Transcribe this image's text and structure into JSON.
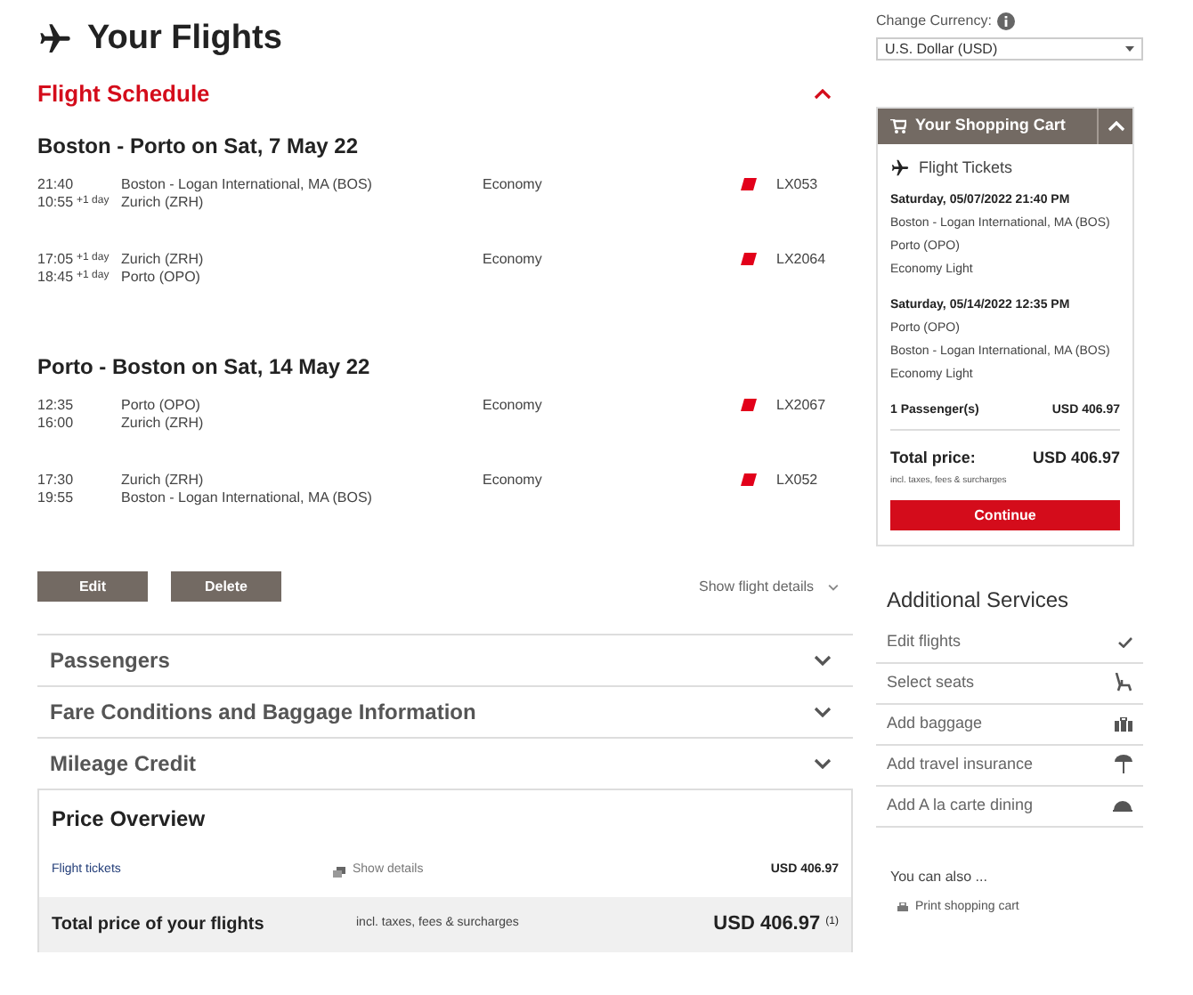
{
  "page_title": "Your Flights",
  "schedule": {
    "title": "Flight Schedule",
    "expanded": true,
    "legs": [
      {
        "heading": "Boston - Porto on Sat, 7 May 22",
        "segments": [
          {
            "dep_time": "21:40",
            "arr_time": "10:55",
            "arr_note": "+1 day",
            "from": "Boston - Logan International, MA (BOS)",
            "to": "Zurich (ZRH)",
            "cabin": "Economy",
            "flight": "LX053"
          },
          {
            "dep_time": "17:05",
            "dep_note": "+1 day",
            "arr_time": "18:45",
            "arr_note": "+1 day",
            "from": "Zurich (ZRH)",
            "to": "Porto (OPO)",
            "cabin": "Economy",
            "flight": "LX2064"
          }
        ]
      },
      {
        "heading": "Porto - Boston on Sat, 14 May 22",
        "segments": [
          {
            "dep_time": "12:35",
            "arr_time": "16:00",
            "from": "Porto (OPO)",
            "to": "Zurich (ZRH)",
            "cabin": "Economy",
            "flight": "LX2067"
          },
          {
            "dep_time": "17:30",
            "arr_time": "19:55",
            "from": "Zurich (ZRH)",
            "to": "Boston - Logan International, MA (BOS)",
            "cabin": "Economy",
            "flight": "LX052"
          }
        ]
      }
    ],
    "buttons": [
      "Edit",
      "Delete"
    ],
    "details_link": "Show flight details"
  },
  "sections": [
    {
      "title": "Passengers",
      "expanded": false
    },
    {
      "title": "Fare Conditions and Baggage Information",
      "expanded": false
    },
    {
      "title": "Mileage Credit",
      "expanded": false
    }
  ],
  "price_overview": {
    "title": "Price Overview",
    "tickets_label": "Flight tickets",
    "show_details": "Show details",
    "tickets_price": "USD 406.97",
    "total_label": "Total price of your flights",
    "total_note": "incl. taxes, fees & surcharges",
    "total_price": "USD 406.97 $^{(1)}$"
  },
  "currency": {
    "label": "Change Currency:",
    "value": "U.S. Dollar (USD)"
  },
  "cart": {
    "title": "Your Shopping Cart",
    "expanded": true,
    "subtitle": "Flight Tickets",
    "trips": [
      {
        "date": "Saturday, 05/07/2022 21:40 PM",
        "lines": [
          "Boston - Logan International, MA (BOS)",
          "Porto (OPO)",
          "Economy Light"
        ]
      },
      {
        "date": "Saturday, 05/14/2022 12:35 PM",
        "lines": [
          "Porto (OPO)",
          "Boston - Logan International, MA (BOS)",
          "Economy Light"
        ]
      }
    ],
    "passengers": "1 Passenger(s)",
    "passengers_price": "USD 406.97",
    "total_label": "Total price:",
    "total_price": "USD 406.97",
    "total_note": "incl. taxes, fees & surcharges",
    "continue": "Continue"
  },
  "additional_services": {
    "title": "Additional Services",
    "items": [
      {
        "label": "Edit flights",
        "kind": "check"
      },
      {
        "label": "Select seats",
        "kind": "seat"
      },
      {
        "label": "Add baggage",
        "kind": "bag"
      },
      {
        "label": "Add travel insurance",
        "kind": "umbrella"
      },
      {
        "label": "Add A la carte dining",
        "kind": "dining"
      }
    ]
  },
  "also": {
    "title": "You can also ...",
    "print": "Print shopping cart"
  }
}
